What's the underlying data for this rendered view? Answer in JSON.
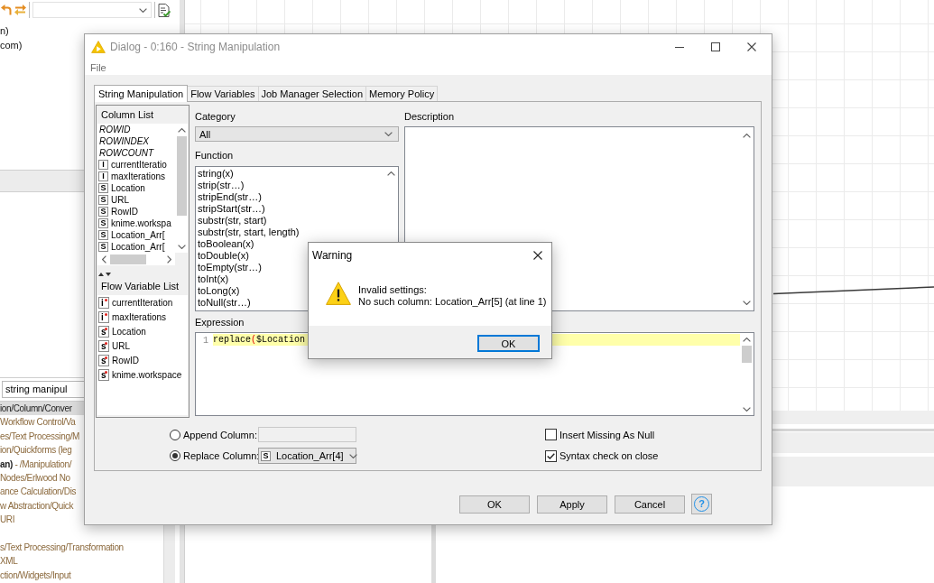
{
  "workbench": {
    "explorer": {
      "items": [
        "n)",
        "com)"
      ]
    },
    "node_repository": {
      "search": {
        "value": "string manipul"
      },
      "results": [
        {
          "text": "ion/Column/Conver",
          "selected": true
        },
        {
          "text": "Workflow Control/Va",
          "selected": false
        },
        {
          "text": "es/Text Processing/M",
          "selected": false
        },
        {
          "text": "ion/Quickforms (leg",
          "selected": false
        },
        {
          "text": "**an)** - /Manipulation/",
          "selected": false
        },
        {
          "text": "Nodes/Erlwood No",
          "selected": false
        },
        {
          "text": "ance Calculation/Dis",
          "selected": false
        },
        {
          "text": "w Abstraction/Quick",
          "selected": false
        },
        {
          "text": "URI",
          "selected": false
        },
        {
          "selected": false
        },
        {
          "text": "s/Text Processing/Transformation",
          "selected": false
        },
        {
          "text": "XML",
          "selected": false
        },
        {
          "text": "ction/Widgets/Input",
          "selected": false
        }
      ]
    }
  },
  "dialog": {
    "title": "Dialog - 0:160 - String Manipulation",
    "menu": [
      "File"
    ],
    "tabs": [
      {
        "label": "String Manipulation",
        "selected": true
      },
      {
        "label": "Flow Variables",
        "selected": false
      },
      {
        "label": "Job Manager Selection",
        "selected": false
      },
      {
        "label": "Memory Policy",
        "selected": false
      }
    ],
    "column_list": {
      "label": "Column List",
      "items": [
        {
          "kind": "special",
          "name": "ROWID"
        },
        {
          "kind": "special",
          "name": "ROWINDEX"
        },
        {
          "kind": "special",
          "name": "ROWCOUNT"
        },
        {
          "kind": "column",
          "type": "I",
          "name": "currentIteratio"
        },
        {
          "kind": "column",
          "type": "I",
          "name": "maxIterations"
        },
        {
          "kind": "column",
          "type": "S",
          "name": "Location"
        },
        {
          "kind": "column",
          "type": "S",
          "name": "URL"
        },
        {
          "kind": "column",
          "type": "S",
          "name": "RowID"
        },
        {
          "kind": "column",
          "type": "S",
          "name": "knime.workspa"
        },
        {
          "kind": "column",
          "type": "S",
          "name": "Location_Arr["
        },
        {
          "kind": "column",
          "type": "S",
          "name": "Location_Arr["
        }
      ]
    },
    "flow_variable_list": {
      "label": "Flow Variable List",
      "items": [
        {
          "type": "i",
          "name": "currentIteration"
        },
        {
          "type": "i",
          "name": "maxIterations"
        },
        {
          "type": "s",
          "name": "Location"
        },
        {
          "type": "s",
          "name": "URL"
        },
        {
          "type": "s",
          "name": "RowID"
        },
        {
          "type": "s",
          "name": "knime.workspace"
        }
      ]
    },
    "category": {
      "label": "Category",
      "value": "All"
    },
    "function": {
      "label": "Function",
      "items": [
        "string(x)",
        "strip(str…)",
        "stripEnd(str…)",
        "stripStart(str…)",
        "substr(str, start)",
        "substr(str, start, length)",
        "toBoolean(x)",
        "toDouble(x)",
        "toEmpty(str…)",
        "toInt(x)",
        "toLong(x)",
        "toNull(str…)"
      ]
    },
    "description": {
      "label": "Description"
    },
    "expression": {
      "label": "Expression",
      "lines": [
        {
          "number": "1",
          "current": true,
          "tokens": [
            {
              "kind": "text",
              "text": "replace"
            },
            {
              "kind": "bracket",
              "text": "("
            },
            {
              "kind": "text",
              "text": "$Location"
            }
          ]
        }
      ]
    },
    "output": [
      {
        "kind": "text_field",
        "label": "Append Column:",
        "selected": false
      },
      {
        "kind": "column_combo",
        "label": "Replace Column:",
        "selected": true,
        "type": "S",
        "value": "Location_Arr[4]"
      }
    ],
    "options": [
      {
        "label": "Insert Missing As Null",
        "checked": false
      },
      {
        "label": "Syntax check on close",
        "checked": true
      }
    ],
    "buttons": [
      "OK",
      "Apply",
      "Cancel"
    ],
    "help": "?"
  },
  "warning": {
    "title": "Warning",
    "message": [
      "Invalid settings:",
      "No such column: Location_Arr[5] (at line 1)"
    ],
    "buttons": [
      {
        "label": "OK",
        "focused": true
      }
    ]
  }
}
